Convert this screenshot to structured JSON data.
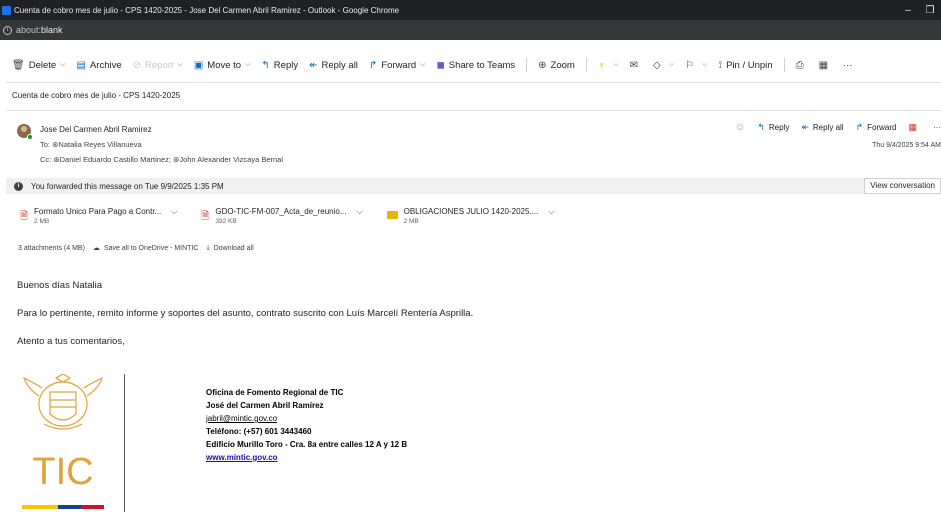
{
  "window": {
    "title": "Cuenta de cobro mes de julio - CPS 1420-2025 - Jose Del Carmen Abril Ramirez - Outlook - Google Chrome",
    "minimize": "–",
    "restore": "❐"
  },
  "address_bar": {
    "scheme": "about:",
    "host": "blank"
  },
  "toolbar": {
    "delete": "Delete",
    "archive": "Archive",
    "report": "Report",
    "move_to": "Move to",
    "reply": "Reply",
    "reply_all": "Reply all",
    "forward": "Forward",
    "share_to_teams": "Share to Teams",
    "zoom": "Zoom",
    "pin_unpin": "Pin / Unpin",
    "more": "···"
  },
  "subject": "Cuenta de cobro mes de julio - CPS 1420-2025",
  "message": {
    "sender": "Jose Del Carmen Abril Ramirez",
    "to_label": "To:",
    "to": "Natalia Reyes Villanueva",
    "cc_label": "Cc:",
    "cc": [
      "Daniel Eduardo Castillo Martinez;",
      "John Alexander Vizcaya Bernal"
    ],
    "date": "Thu 9/4/2025 9:54 AM",
    "actions": {
      "reply": "Reply",
      "reply_all": "Reply all",
      "forward": "Forward",
      "more": "···"
    }
  },
  "info_bar": {
    "text": "You forwarded this message on Tue 9/9/2025 1:35 PM",
    "view_conversation": "View conversation"
  },
  "attachments": [
    {
      "name": "Formato Unico Para Pago a Contr...",
      "size": "2 MB"
    },
    {
      "name": "GDO-TIC-FM-007_Acta_de_reunio...",
      "size": "392 KB"
    },
    {
      "name": "OBLIGACIONES JULIO 1420-2025....",
      "size": "2 MB"
    }
  ],
  "attachment_summary": {
    "count": "3 attachments (4 MB)",
    "save_all": "Save all to OneDrive - MINTIC",
    "download_all": "Download all"
  },
  "body": {
    "greeting": "Buenos días Natalia",
    "paragraph": "Para lo pertinente, remito informe y soportes del asunto, contrato suscrito con Luís Marcelí Rentería Asprilla.",
    "closing": "Atento a tus comentarios,"
  },
  "signature": {
    "logo_text": "TIC",
    "office": "Oficina de Fomento Regional de TIC",
    "name": "José del Carmen Abril Ramírez",
    "email": "jabril@mintic.gov.co",
    "phone": "Teléfono: (+57) 601 3443460",
    "address": "Edificio Murillo Toro - Cra. 8a entre calles 12 A y 12 B",
    "website": "www.mintic.gov.co"
  },
  "colors": {
    "accent": "#0f6cbd",
    "logo_gold": "#e0a33a",
    "flag_yellow": "#f7c600",
    "flag_blue": "#1c3f94",
    "flag_red": "#d1112b"
  }
}
